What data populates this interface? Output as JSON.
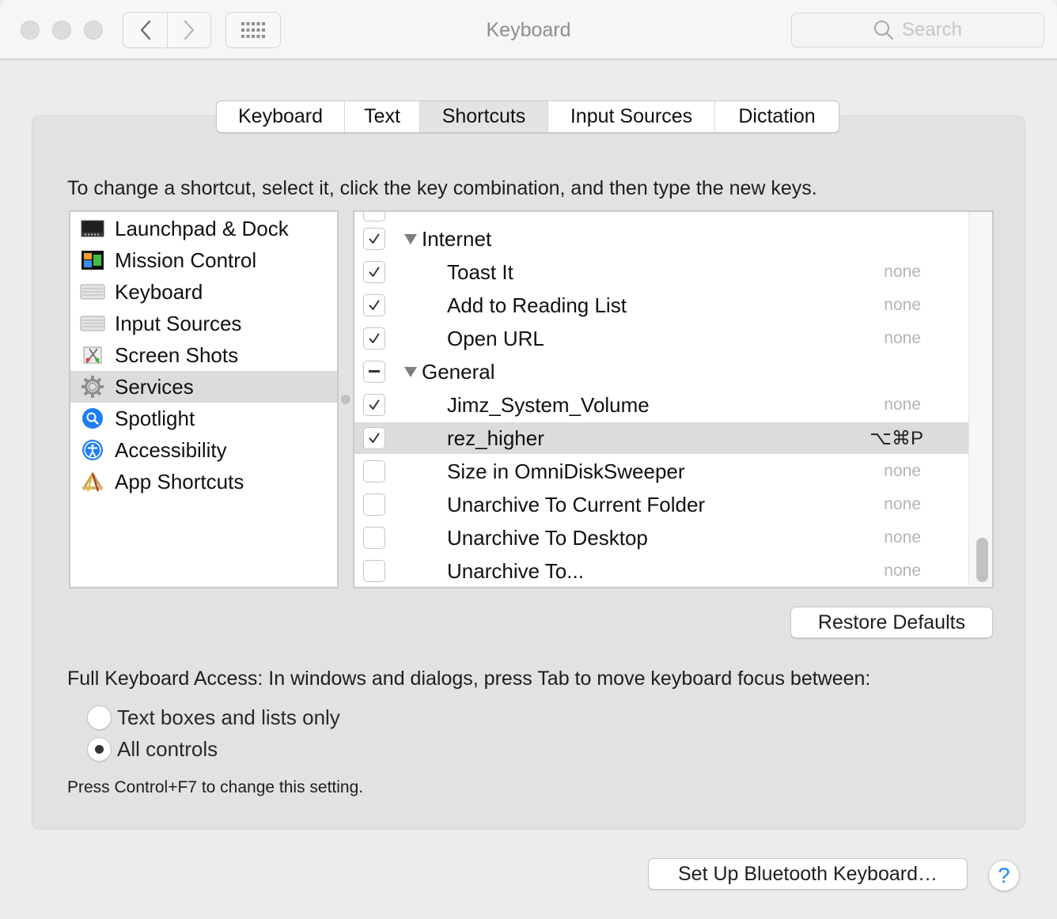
{
  "window": {
    "title": "Keyboard",
    "search_placeholder": "Search"
  },
  "tabs": [
    {
      "label": "Keyboard",
      "active": false
    },
    {
      "label": "Text",
      "active": false
    },
    {
      "label": "Shortcuts",
      "active": true
    },
    {
      "label": "Input Sources",
      "active": false
    },
    {
      "label": "Dictation",
      "active": false
    }
  ],
  "instructions": "To change a shortcut, select it, click the key combination, and then type the new keys.",
  "categories": [
    {
      "label": "Launchpad & Dock",
      "icon": "launchpad-dock-icon",
      "selected": false
    },
    {
      "label": "Mission Control",
      "icon": "mission-control-icon",
      "selected": false
    },
    {
      "label": "Keyboard",
      "icon": "keyboard-icon",
      "selected": false
    },
    {
      "label": "Input Sources",
      "icon": "input-sources-icon",
      "selected": false
    },
    {
      "label": "Screen Shots",
      "icon": "screenshot-icon",
      "selected": false
    },
    {
      "label": "Services",
      "icon": "gear-icon",
      "selected": true
    },
    {
      "label": "Spotlight",
      "icon": "spotlight-icon",
      "selected": false
    },
    {
      "label": "Accessibility",
      "icon": "accessibility-icon",
      "selected": false
    },
    {
      "label": "App Shortcuts",
      "icon": "app-shortcuts-icon",
      "selected": false
    }
  ],
  "shortcuts": [
    {
      "type": "group",
      "label": "Internet",
      "state": "checked",
      "shortcut": ""
    },
    {
      "type": "item",
      "label": "Toast It",
      "state": "checked",
      "shortcut": "none"
    },
    {
      "type": "item",
      "label": "Add to Reading List",
      "state": "checked",
      "shortcut": "none"
    },
    {
      "type": "item",
      "label": "Open URL",
      "state": "checked",
      "shortcut": "none"
    },
    {
      "type": "group",
      "label": "General",
      "state": "mixed",
      "shortcut": ""
    },
    {
      "type": "item",
      "label": "Jimz_System_Volume",
      "state": "checked",
      "shortcut": "none"
    },
    {
      "type": "item",
      "label": "rez_higher",
      "state": "checked",
      "shortcut": "⌥⌘P",
      "selected": true
    },
    {
      "type": "item",
      "label": "Size in OmniDiskSweeper",
      "state": "unchecked",
      "shortcut": "none"
    },
    {
      "type": "item",
      "label": "Unarchive To Current Folder",
      "state": "unchecked",
      "shortcut": "none"
    },
    {
      "type": "item",
      "label": "Unarchive To Desktop",
      "state": "unchecked",
      "shortcut": "none"
    },
    {
      "type": "item",
      "label": "Unarchive To...",
      "state": "unchecked",
      "shortcut": "none"
    }
  ],
  "buttons": {
    "restore_defaults": "Restore Defaults",
    "bluetooth": "Set Up Bluetooth Keyboard…",
    "help": "?"
  },
  "full_keyboard_access": {
    "label": "Full Keyboard Access: In windows and dialogs, press Tab to move keyboard focus between:",
    "options": [
      {
        "label": "Text boxes and lists only",
        "selected": false
      },
      {
        "label": "All controls",
        "selected": true
      }
    ],
    "hint": "Press Control+F7 to change this setting."
  }
}
